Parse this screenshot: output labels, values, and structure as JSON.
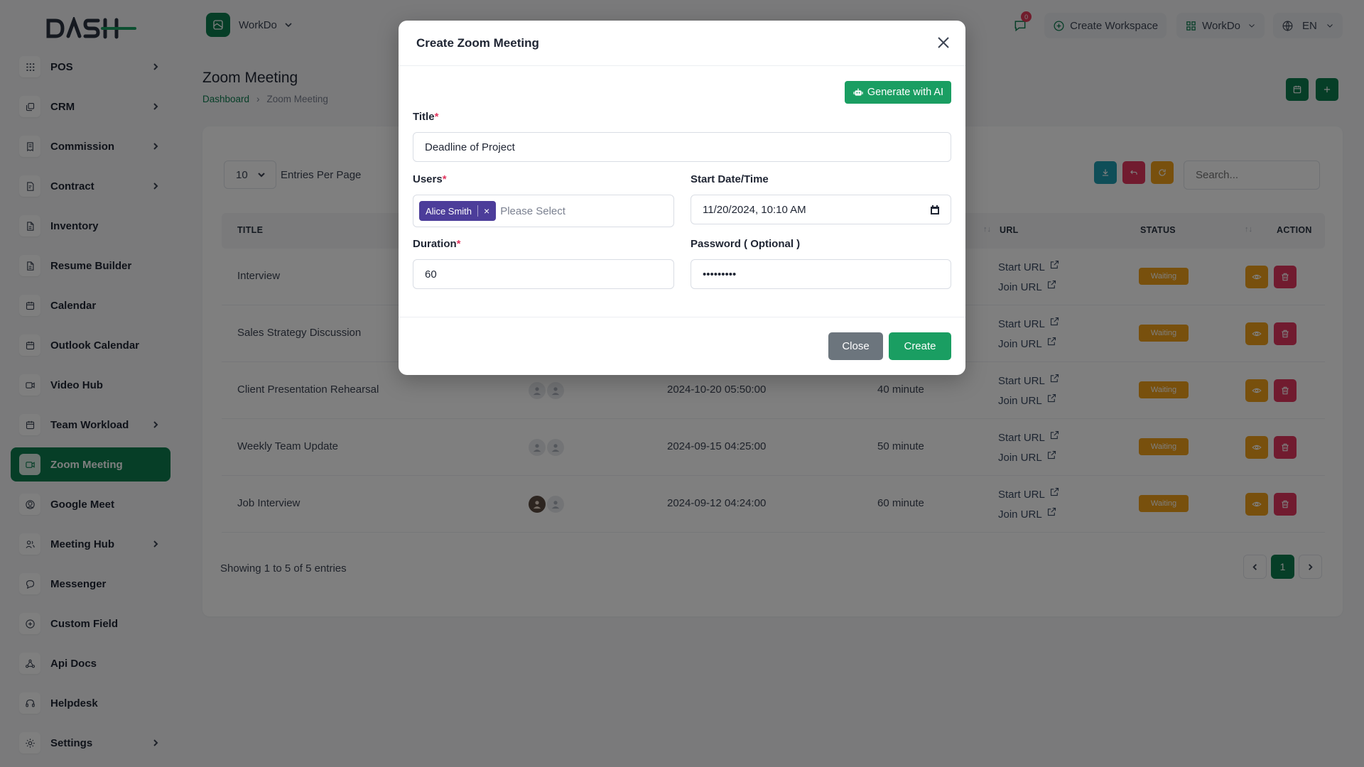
{
  "brand": {
    "logo_text": "DASH",
    "accent": "#0c7d4f"
  },
  "sidebar": {
    "items": [
      {
        "label": "POS",
        "icon": "grid-icon",
        "has_children": true
      },
      {
        "label": "CRM",
        "icon": "layers-icon",
        "has_children": true
      },
      {
        "label": "Commission",
        "icon": "receipt-icon",
        "has_children": true
      },
      {
        "label": "Contract",
        "icon": "contract-icon",
        "has_children": true
      },
      {
        "label": "Inventory",
        "icon": "file-icon",
        "has_children": false
      },
      {
        "label": "Resume Builder",
        "icon": "file-icon",
        "has_children": false
      },
      {
        "label": "Calendar",
        "icon": "calendar-icon",
        "has_children": false
      },
      {
        "label": "Outlook Calendar",
        "icon": "calendar-icon",
        "has_children": false
      },
      {
        "label": "Video Hub",
        "icon": "video-icon",
        "has_children": false
      },
      {
        "label": "Team Workload",
        "icon": "calendar-icon",
        "has_children": true
      },
      {
        "label": "Zoom Meeting",
        "icon": "video-camera-icon",
        "has_children": false,
        "active": true
      },
      {
        "label": "Google Meet",
        "icon": "meet-icon",
        "has_children": false
      },
      {
        "label": "Meeting Hub",
        "icon": "users-icon",
        "has_children": true
      },
      {
        "label": "Messenger",
        "icon": "chat-icon",
        "has_children": false
      },
      {
        "label": "Custom Field",
        "icon": "plus-circle-icon",
        "has_children": false
      },
      {
        "label": "Api Docs",
        "icon": "webhook-icon",
        "has_children": false
      },
      {
        "label": "Helpdesk",
        "icon": "headset-icon",
        "has_children": false
      },
      {
        "label": "Settings",
        "icon": "gear-icon",
        "has_children": true
      }
    ]
  },
  "header": {
    "workspace": "WorkDo",
    "notification_count": "0",
    "create_workspace": "Create Workspace",
    "workspace_switch": "WorkDo",
    "language": "EN"
  },
  "page": {
    "title": "Zoom Meeting",
    "breadcrumb": [
      "Dashboard",
      "Zoom Meeting"
    ]
  },
  "table": {
    "per_page": "10",
    "per_page_label": "Entries Per Page",
    "search_placeholder": "Search...",
    "columns": {
      "title": "TITLE",
      "url": "URL",
      "status": "STATUS",
      "action": "ACTION"
    },
    "rows": [
      {
        "title": "Interview",
        "date": "",
        "duration": "",
        "start": "Start URL",
        "join": "Join URL",
        "status": "Waiting",
        "avatars": []
      },
      {
        "title": "Sales Strategy Discussion",
        "date": "",
        "duration": "",
        "start": "Start URL",
        "join": "Join URL",
        "status": "Waiting",
        "avatars": []
      },
      {
        "title": "Client Presentation Rehearsal",
        "date": "2024-10-20 05:50:00",
        "duration": "40 minute",
        "start": "Start URL",
        "join": "Join URL",
        "status": "Waiting",
        "avatars": [
          "placeholder",
          "placeholder"
        ]
      },
      {
        "title": "Weekly Team Update",
        "date": "2024-09-15 04:25:00",
        "duration": "50 minute",
        "start": "Start URL",
        "join": "Join URL",
        "status": "Waiting",
        "avatars": [
          "placeholder",
          "placeholder"
        ]
      },
      {
        "title": "Job Interview",
        "date": "2024-09-12 04:24:00",
        "duration": "60 minute",
        "start": "Start URL",
        "join": "Join URL",
        "status": "Waiting",
        "avatars": [
          "photo",
          "placeholder"
        ]
      }
    ],
    "showing": "Showing 1 to 5 of 5 entries",
    "current_page": "1"
  },
  "modal": {
    "title": "Create Zoom Meeting",
    "ai_button": "Generate with AI",
    "title_label": "Title",
    "title_value": "Deadline of Project",
    "users_label": "Users",
    "selected_user": "Alice Smith",
    "users_placeholder": "Please Select",
    "start_label": "Start Date/Time",
    "start_value": "11/20/2024, 10:10 AM",
    "duration_label": "Duration",
    "duration_value": "60",
    "password_label": "Password ( Optional )",
    "password_value": "•••••••••",
    "required_mark": "*",
    "close_button": "Close",
    "create_button": "Create"
  }
}
